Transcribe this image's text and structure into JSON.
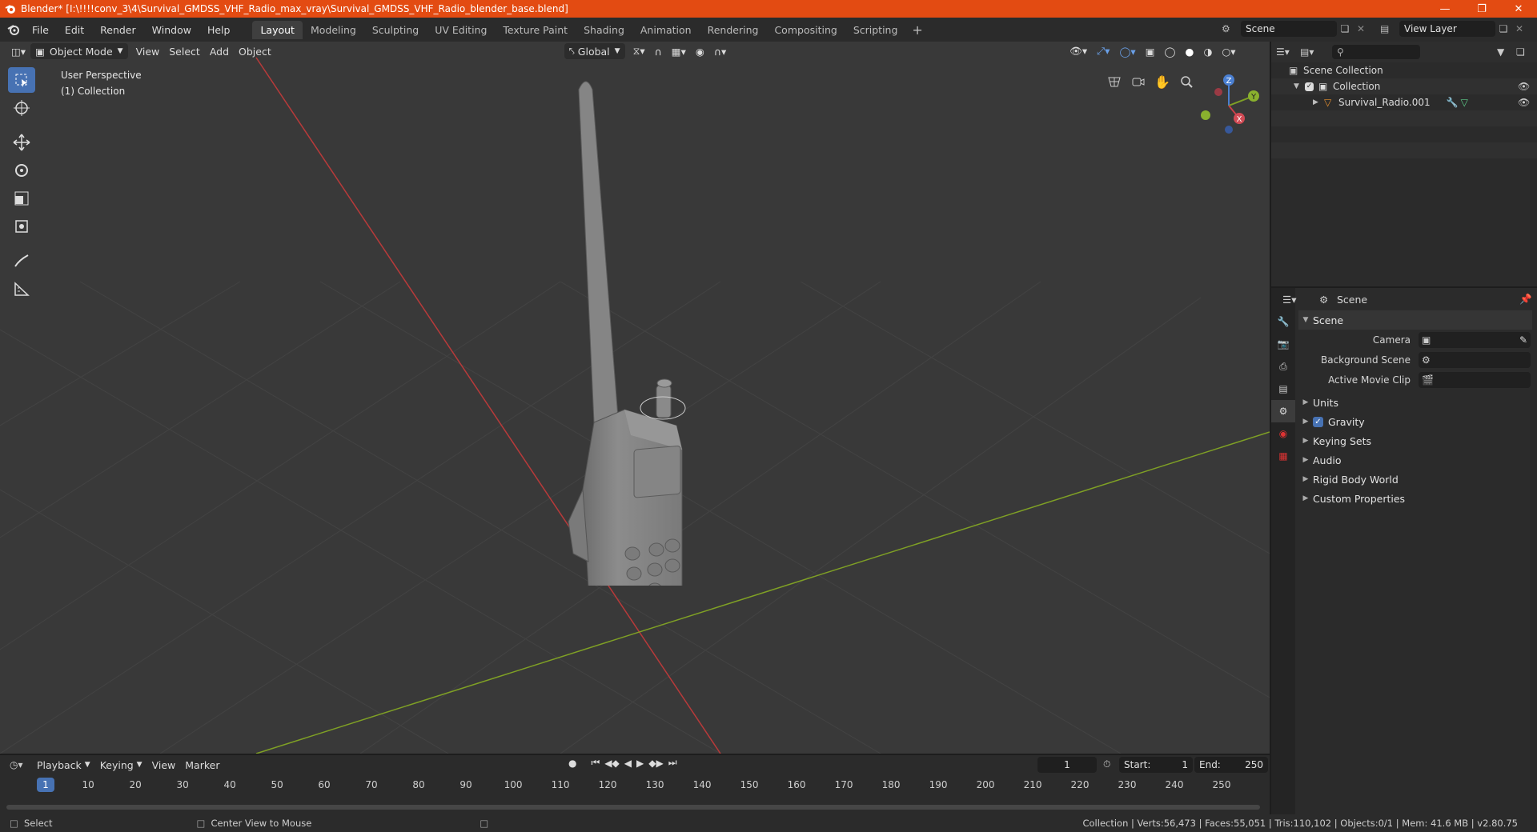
{
  "window": {
    "title": "Blender* [I:\\!!!!conv_3\\4\\Survival_GMDSS_VHF_Radio_max_vray\\Survival_GMDSS_VHF_Radio_blender_base.blend]",
    "controls": [
      "minimize-icon",
      "maximize-icon",
      "close-icon"
    ]
  },
  "menu": [
    "File",
    "Edit",
    "Render",
    "Window",
    "Help"
  ],
  "workspaces": [
    "Layout",
    "Modeling",
    "Sculpting",
    "UV Editing",
    "Texture Paint",
    "Shading",
    "Animation",
    "Rendering",
    "Compositing",
    "Scripting"
  ],
  "active_workspace": "Layout",
  "scene_selector": "Scene",
  "view_layer_selector": "View Layer",
  "viewport": {
    "mode": "Object Mode",
    "menus": [
      "View",
      "Select",
      "Add",
      "Object"
    ],
    "transform_orientation": "Global",
    "info_line1": "User Perspective",
    "info_line2": "(1) Collection",
    "gizmo_axes": [
      "X",
      "Y",
      "Z"
    ]
  },
  "outliner": {
    "rows": [
      {
        "label": "Scene Collection"
      },
      {
        "label": "Collection"
      },
      {
        "label": "Survival_Radio.001"
      }
    ]
  },
  "properties": {
    "header": "Scene",
    "panel_title": "Scene",
    "fields": [
      {
        "label": "Camera",
        "value": ""
      },
      {
        "label": "Background Scene",
        "value": ""
      },
      {
        "label": "Active Movie Clip",
        "value": ""
      }
    ],
    "subpanels": [
      "Units",
      "Gravity",
      "Keying Sets",
      "Audio",
      "Rigid Body World",
      "Custom Properties"
    ],
    "gravity_enabled": true
  },
  "timeline": {
    "menus": [
      "Playback",
      "Keying",
      "View",
      "Marker"
    ],
    "current_frame": "1",
    "start_label": "Start:",
    "start": "1",
    "end_label": "End:",
    "end": "250",
    "ruler": [
      "1",
      "10",
      "20",
      "30",
      "40",
      "50",
      "60",
      "70",
      "80",
      "90",
      "100",
      "110",
      "120",
      "130",
      "140",
      "150",
      "160",
      "170",
      "180",
      "190",
      "200",
      "210",
      "220",
      "230",
      "240",
      "250"
    ]
  },
  "status": {
    "left1": "Select",
    "left2": "Center View to Mouse",
    "right": "Collection | Verts:56,473 | Faces:55,051 | Tris:110,102 | Objects:0/1 | Mem: 41.6 MB | v2.80.75"
  },
  "colors": {
    "accent": "#4772b3",
    "titlebar": "#e34b12",
    "x_axis": "#b83a3a",
    "y_axis": "#7fa025"
  }
}
